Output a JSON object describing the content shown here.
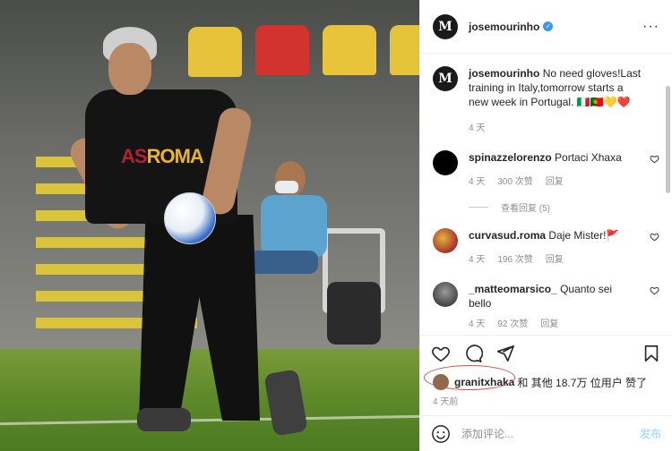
{
  "photo": {
    "shirt_logo_prefix": "AS",
    "shirt_logo_rest": "ROMA"
  },
  "header": {
    "username": "josemourinho",
    "avatar_initials": "M",
    "more_label": "···"
  },
  "caption": {
    "username": "josemourinho",
    "text": "No need gloves!Last training in Italy,tomorrow starts a new week in Portugal.",
    "flags": "🇮🇹🇵🇹💛❤️",
    "time": "4 天"
  },
  "comments": [
    {
      "username": "spinazzelorenzo",
      "text": "Portaci Xhaxa",
      "time": "4 天",
      "likes": "300 次赞",
      "reply": "回复",
      "avatar_color": "#000000"
    },
    {
      "username": "curvasud.roma",
      "text": "Daje Mister!🚩",
      "time": "4 天",
      "likes": "196 次赞",
      "reply": "回复",
      "avatar_color": "#8a1f22"
    },
    {
      "username": "_matteomarsico_",
      "text": "Quanto sei bello",
      "time": "4 天",
      "likes": "92 次赞",
      "reply": "回复",
      "avatar_color": "#6b6b6b"
    }
  ],
  "view_replies": "查看回复 (5)",
  "likes": {
    "user": "granitxhaka",
    "rest": "和 其他 18.7万 位用户 赞了"
  },
  "posted_time": "4 天前",
  "add_comment": {
    "placeholder": "添加评论...",
    "post_label": "发布"
  },
  "colors": {
    "link_blue": "#3897f0",
    "post_disabled": "#b2dffc",
    "highlight_oval": "#d34b4b"
  },
  "icons": [
    "like-icon",
    "comment-icon",
    "share-icon",
    "save-icon",
    "emoji-icon",
    "verified-icon"
  ]
}
